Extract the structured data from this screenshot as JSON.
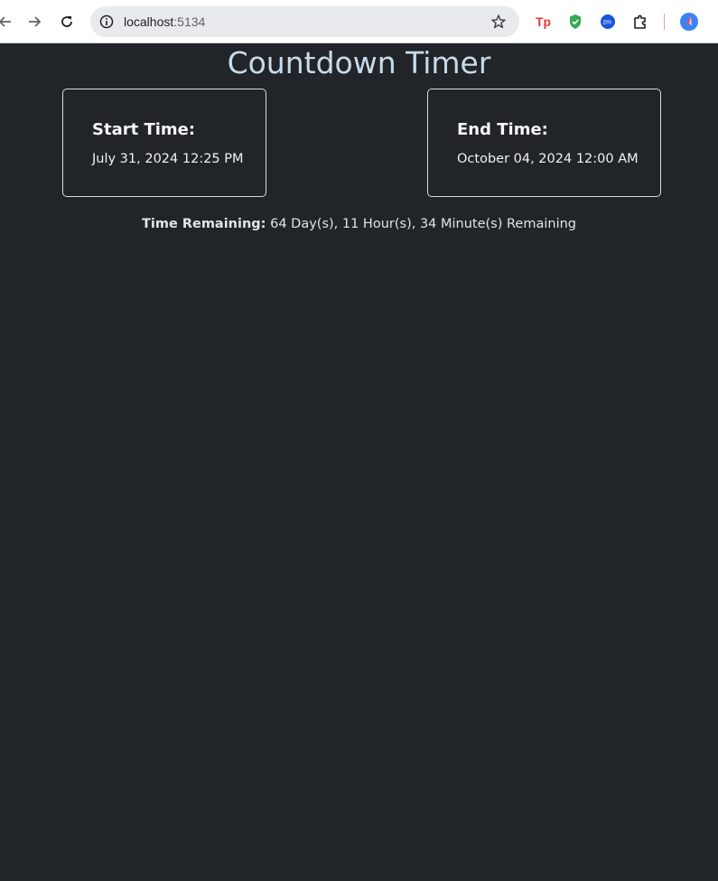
{
  "browser": {
    "url_host": "localhost",
    "url_port": ":5134",
    "extensions": [
      "tp-extension-icon",
      "shield-check-icon",
      "zm-extension-icon",
      "puzzle-icon",
      "profile-icon"
    ]
  },
  "page": {
    "title": "Countdown Timer",
    "start_card": {
      "label": "Start Time:",
      "value": "July 31, 2024 12:25 PM"
    },
    "end_card": {
      "label": "End Time:",
      "value": "October 04, 2024 12:00 AM"
    },
    "remaining": {
      "label": "Time Remaining:",
      "value": " 64 Day(s), 11 Hour(s), 34 Minute(s) Remaining"
    }
  },
  "colors": {
    "background": "#212428",
    "title": "#c9dbe9",
    "card_border": "#d7dde2",
    "text": "#f0f2f4"
  }
}
